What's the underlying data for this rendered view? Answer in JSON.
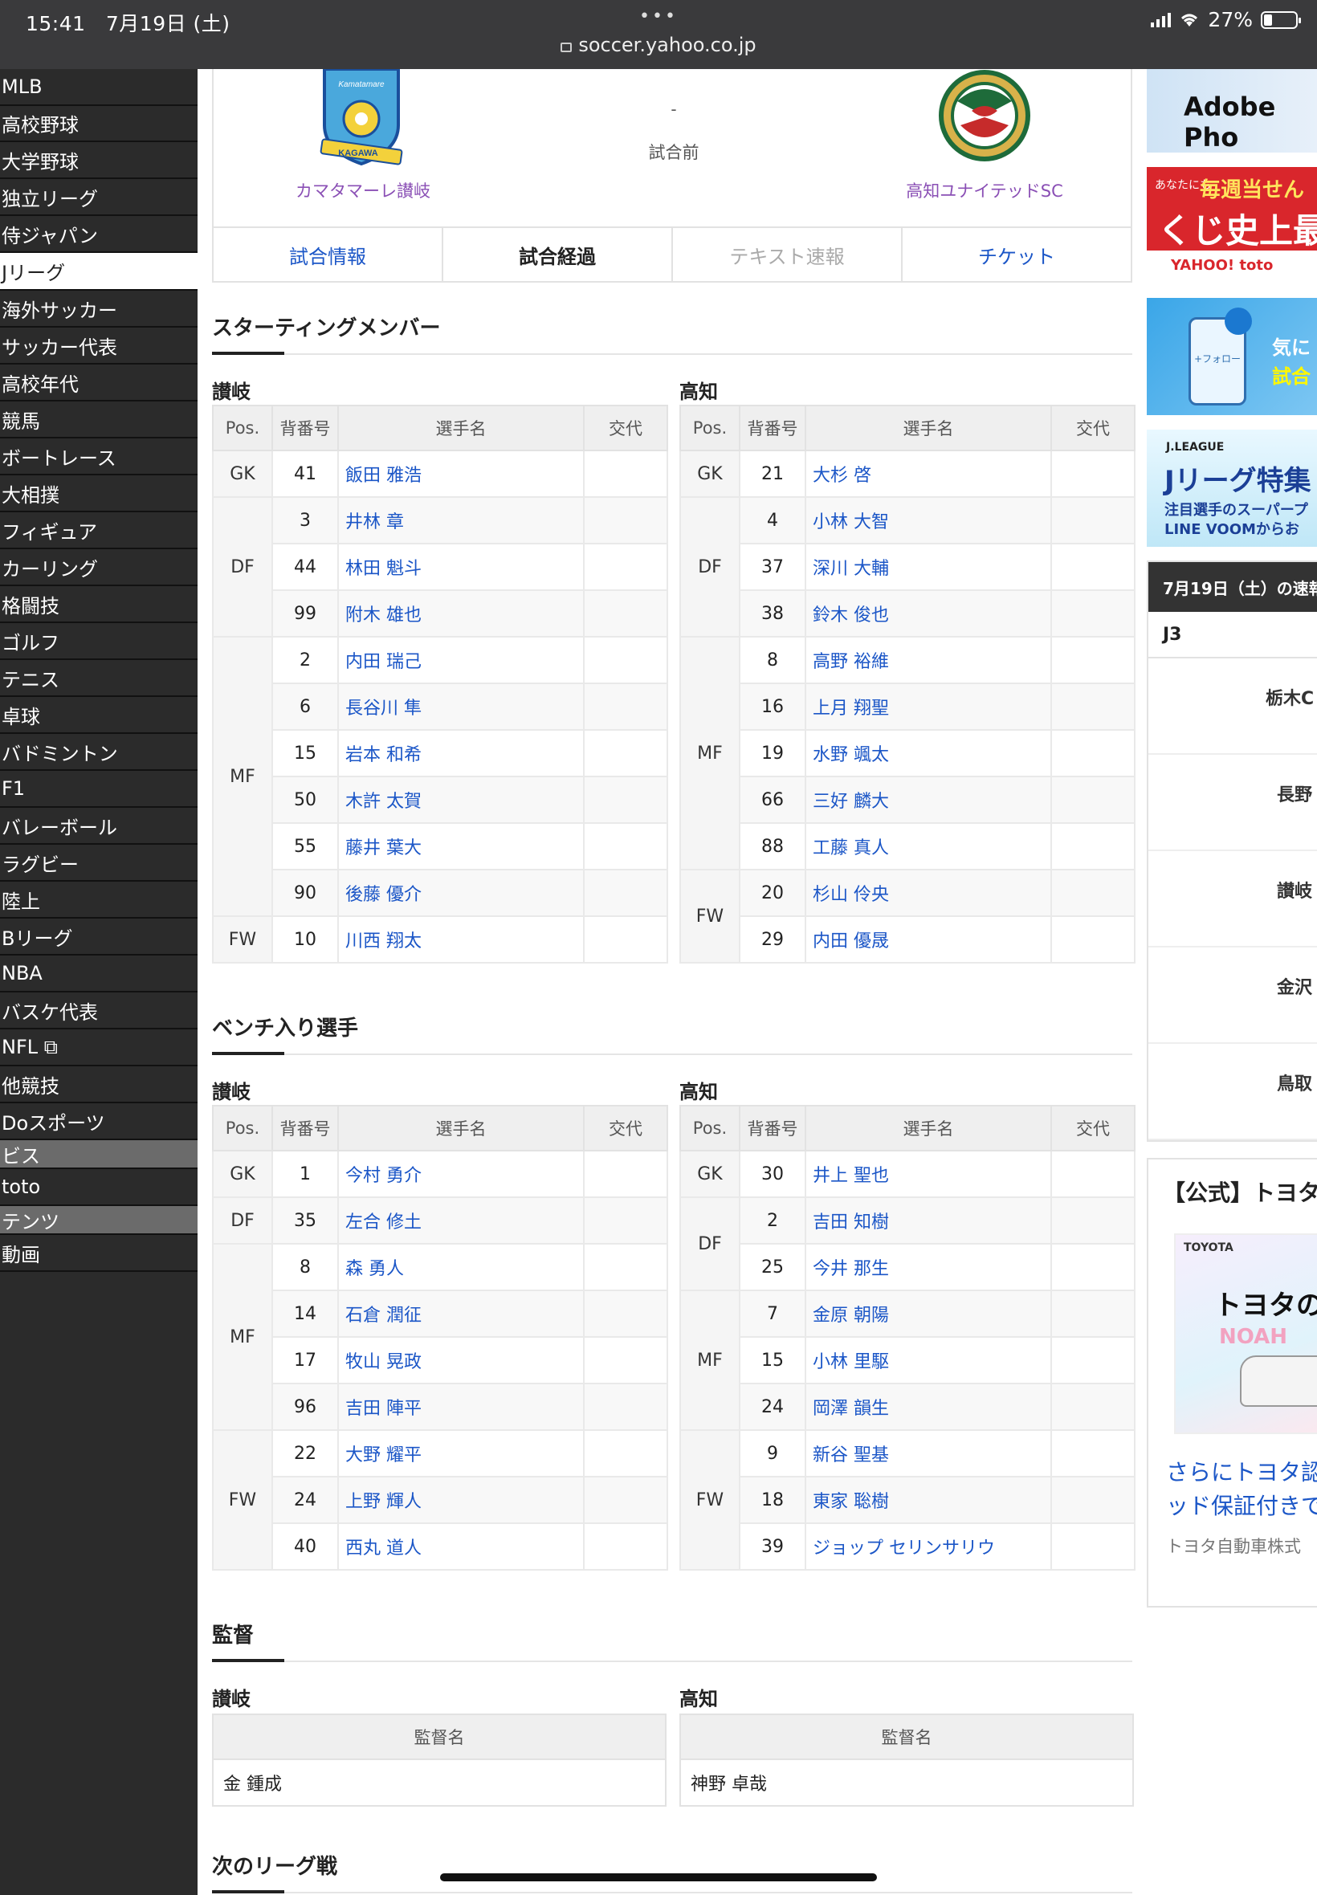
{
  "status_bar": {
    "time": "15:41",
    "date": "7月19日 (土)",
    "battery": "27%",
    "url": "soccer.yahoo.co.jp"
  },
  "sidebar": {
    "items": [
      {
        "label": "MLB"
      },
      {
        "label": "高校野球"
      },
      {
        "label": "大学野球"
      },
      {
        "label": "独立リーグ"
      },
      {
        "label": "侍ジャパン"
      },
      {
        "label": "Jリーグ",
        "active": true
      },
      {
        "label": "海外サッカー"
      },
      {
        "label": "サッカー代表"
      },
      {
        "label": "高校年代"
      },
      {
        "label": "競馬"
      },
      {
        "label": "ボートレース"
      },
      {
        "label": "大相撲"
      },
      {
        "label": "フィギュア"
      },
      {
        "label": "カーリング"
      },
      {
        "label": "格闘技"
      },
      {
        "label": "ゴルフ"
      },
      {
        "label": "テニス"
      },
      {
        "label": "卓球"
      },
      {
        "label": "バドミントン"
      },
      {
        "label": "F1"
      },
      {
        "label": "バレーボール"
      },
      {
        "label": "ラグビー"
      },
      {
        "label": "陸上"
      },
      {
        "label": "Bリーグ"
      },
      {
        "label": "NBA"
      },
      {
        "label": "バスケ代表"
      },
      {
        "label": "NFL ⧉"
      },
      {
        "label": "他競技"
      },
      {
        "label": "Doスポーツ"
      },
      {
        "label": "ビス"
      },
      {
        "label": "toto"
      },
      {
        "label": "テンツ"
      },
      {
        "label": "動画"
      }
    ]
  },
  "match": {
    "home_team": "カマタマーレ讃岐",
    "away_team": "高知ユナイテッドSC",
    "score": "-",
    "status": "試合前",
    "home_logo_text": "Kamatamare",
    "home_logo_sub": "KAGAWA"
  },
  "tabs": [
    {
      "label": "試合情報",
      "state": "link"
    },
    {
      "label": "試合経過",
      "state": "current"
    },
    {
      "label": "テキスト速報",
      "state": "disabled"
    },
    {
      "label": "チケット",
      "state": "link"
    }
  ],
  "columns": {
    "pos": "Pos.",
    "num": "背番号",
    "name": "選手名",
    "sub": "交代",
    "coach": "監督名"
  },
  "starting": {
    "title": "スターティングメンバー",
    "home": {
      "label": "讃岐",
      "groups": [
        {
          "pos": "GK",
          "players": [
            {
              "num": "41",
              "name": "飯田 雅浩"
            }
          ]
        },
        {
          "pos": "DF",
          "players": [
            {
              "num": "3",
              "name": "井林 章"
            },
            {
              "num": "44",
              "name": "林田 魁斗"
            },
            {
              "num": "99",
              "name": "附木 雄也"
            }
          ]
        },
        {
          "pos": "MF",
          "players": [
            {
              "num": "2",
              "name": "内田 瑞己"
            },
            {
              "num": "6",
              "name": "長谷川 隼"
            },
            {
              "num": "15",
              "name": "岩本 和希"
            },
            {
              "num": "50",
              "name": "木許 太賀"
            },
            {
              "num": "55",
              "name": "藤井 葉大"
            },
            {
              "num": "90",
              "name": "後藤 優介"
            }
          ]
        },
        {
          "pos": "FW",
          "players": [
            {
              "num": "10",
              "name": "川西 翔太"
            }
          ]
        }
      ]
    },
    "away": {
      "label": "高知",
      "groups": [
        {
          "pos": "GK",
          "players": [
            {
              "num": "21",
              "name": "大杉 啓"
            }
          ]
        },
        {
          "pos": "DF",
          "players": [
            {
              "num": "4",
              "name": "小林 大智"
            },
            {
              "num": "37",
              "name": "深川 大輔"
            },
            {
              "num": "38",
              "name": "鈴木 俊也"
            }
          ]
        },
        {
          "pos": "MF",
          "players": [
            {
              "num": "8",
              "name": "高野 裕維"
            },
            {
              "num": "16",
              "name": "上月 翔聖"
            },
            {
              "num": "19",
              "name": "水野 颯太"
            },
            {
              "num": "66",
              "name": "三好 麟大"
            },
            {
              "num": "88",
              "name": "工藤 真人"
            }
          ]
        },
        {
          "pos": "FW",
          "players": [
            {
              "num": "20",
              "name": "杉山 伶央"
            },
            {
              "num": "29",
              "name": "内田 優晟"
            }
          ]
        }
      ]
    }
  },
  "bench": {
    "title": "ベンチ入り選手",
    "home": {
      "label": "讃岐",
      "groups": [
        {
          "pos": "GK",
          "players": [
            {
              "num": "1",
              "name": "今村 勇介"
            }
          ]
        },
        {
          "pos": "DF",
          "players": [
            {
              "num": "35",
              "name": "左合 修土"
            }
          ]
        },
        {
          "pos": "MF",
          "players": [
            {
              "num": "8",
              "name": "森 勇人"
            },
            {
              "num": "14",
              "name": "石倉 潤征"
            },
            {
              "num": "17",
              "name": "牧山 晃政"
            },
            {
              "num": "96",
              "name": "吉田 陣平"
            }
          ]
        },
        {
          "pos": "FW",
          "players": [
            {
              "num": "22",
              "name": "大野 耀平"
            },
            {
              "num": "24",
              "name": "上野 輝人"
            },
            {
              "num": "40",
              "name": "西丸 道人"
            }
          ]
        }
      ]
    },
    "away": {
      "label": "高知",
      "groups": [
        {
          "pos": "GK",
          "players": [
            {
              "num": "30",
              "name": "井上 聖也"
            }
          ]
        },
        {
          "pos": "DF",
          "players": [
            {
              "num": "2",
              "name": "吉田 知樹"
            },
            {
              "num": "25",
              "name": "今井 那生"
            }
          ]
        },
        {
          "pos": "MF",
          "players": [
            {
              "num": "7",
              "name": "金原 朝陽"
            },
            {
              "num": "15",
              "name": "小林 里駆"
            },
            {
              "num": "24",
              "name": "岡澤 韻生"
            }
          ]
        },
        {
          "pos": "FW",
          "players": [
            {
              "num": "9",
              "name": "新谷 聖基"
            },
            {
              "num": "18",
              "name": "東家 聡樹"
            },
            {
              "num": "39",
              "name": "ジョップ セリンサリウ"
            }
          ]
        }
      ]
    }
  },
  "manager": {
    "title": "監督",
    "home": {
      "label": "讃岐",
      "name": "金 鍾成"
    },
    "away": {
      "label": "高知",
      "name": "神野 卓哉"
    }
  },
  "next": {
    "title": "次のリーグ戦"
  },
  "right": {
    "ad_adobe": "Adobe Pho",
    "ad_toto_small": "あなたにも",
    "ad_toto_l1": "毎週当せん",
    "ad_toto_l2": "くじ史上最",
    "ad_toto_brand": "YAHOO! toto",
    "ad_follow_btn": "+フォロー",
    "ad_follow_t1": "気に",
    "ad_follow_t2": "試合",
    "ad_jl_logo": "J.LEAGUE",
    "ad_jl_t1": "Jリーグ特集",
    "ad_jl_t2": "注目選手のスーパープ",
    "ad_jl_t3": "LINE VOOMからお",
    "results_header": "7月19日（土）の速報",
    "results_league": "J3",
    "results_rows": [
      "栃木C",
      "長野",
      "讃岐",
      "金沢",
      "鳥取"
    ],
    "toyota_title": "【公式】トヨタ",
    "toyota_brand": "TOYOTA",
    "toyota_big": "トヨタの",
    "toyota_car": "NOAH",
    "toyota_d1": "さらにトヨタ認",
    "toyota_d2": "ッド保証付きで",
    "toyota_d3": "トヨタ自動車株式"
  }
}
